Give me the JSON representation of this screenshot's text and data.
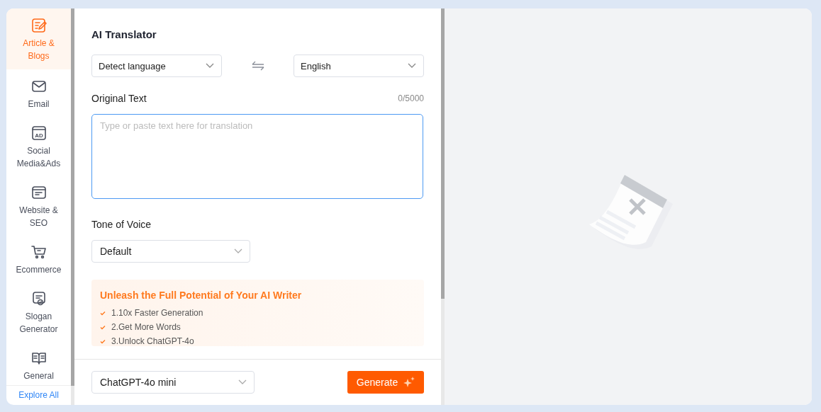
{
  "sidebar": {
    "items": [
      {
        "kind": "article",
        "label": "Article &\nBlogs",
        "selected": true
      },
      {
        "kind": "email",
        "label": "Email",
        "selected": false
      },
      {
        "kind": "ad",
        "icon_text": "AD",
        "label": "Social\nMedia&Ads",
        "selected": false
      },
      {
        "kind": "website",
        "label": "Website &\nSEO",
        "selected": false
      },
      {
        "kind": "cart",
        "label": "Ecommerce",
        "selected": false
      },
      {
        "kind": "slogan",
        "label": "Slogan\nGenerator",
        "selected": false
      },
      {
        "kind": "book",
        "label": "General",
        "selected": false
      }
    ],
    "footer_link": "Explore All"
  },
  "form": {
    "title": "AI Translator",
    "source_language": "Detect language",
    "target_language": "English",
    "original_text": {
      "label": "Original Text",
      "counter": "0/5000",
      "placeholder": "Type or paste text here for translation"
    },
    "tone": {
      "label": "Tone of Voice",
      "value": "Default"
    },
    "promo": {
      "title": "Unleash the Full Potential of Your AI Writer",
      "items": [
        "1.10x Faster Generation",
        "2.Get More Words",
        "3.Unlock ChatGPT-4o"
      ]
    }
  },
  "footer": {
    "model": "ChatGPT-4o mini",
    "generate_button": "Generate"
  },
  "preview": {
    "kind": "empty"
  }
}
